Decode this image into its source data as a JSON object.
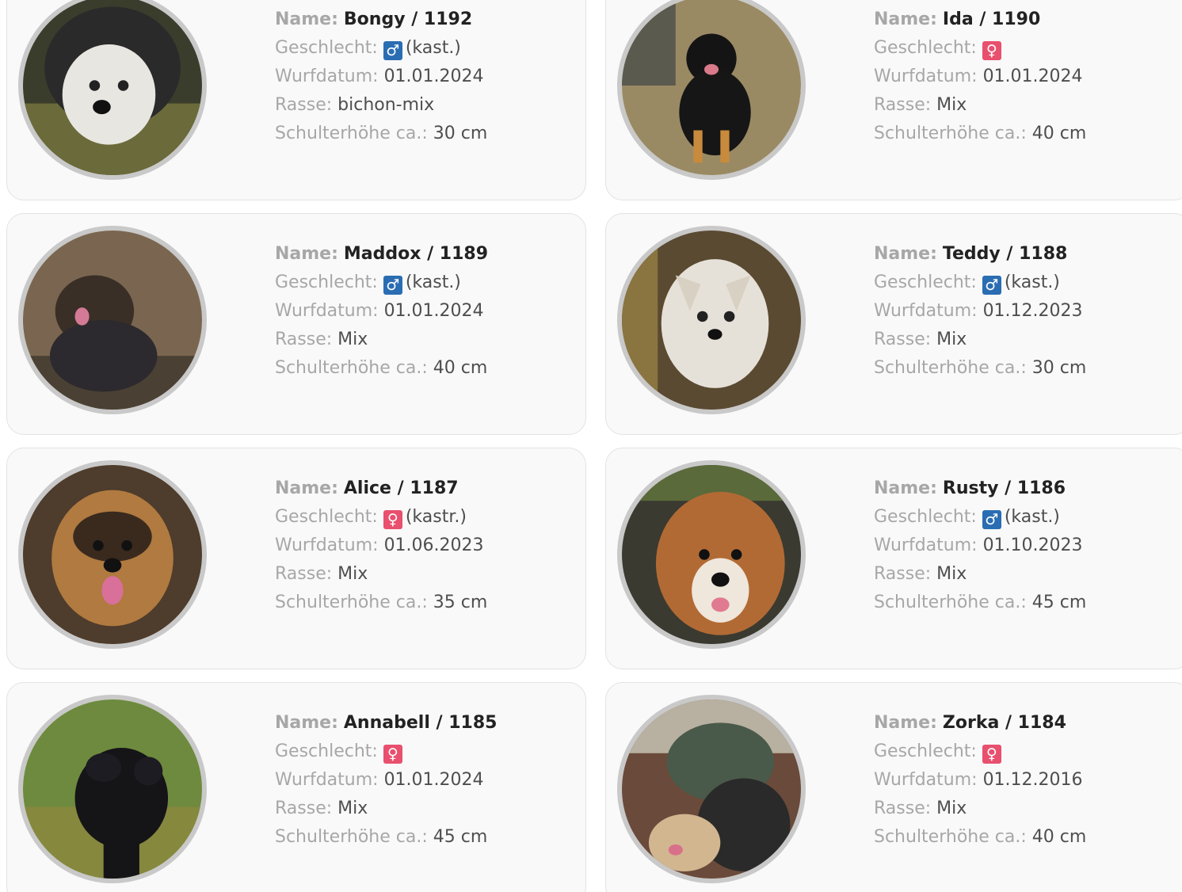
{
  "labels": {
    "name": "Name:",
    "sex": "Geschlecht:",
    "birth": "Wurfdatum:",
    "breed": "Rasse:",
    "height": "Schulterhöhe ca.:"
  },
  "dogs": [
    {
      "name": "Bongy / 1192",
      "sex_symbol": "♂",
      "sex": "male",
      "castration": "(kast.)",
      "birth": "01.01.2024",
      "breed": "bichon-mix",
      "height": "30 cm"
    },
    {
      "name": "Ida / 1190",
      "sex_symbol": "♀",
      "sex": "female",
      "castration": "",
      "birth": "01.01.2024",
      "breed": "Mix",
      "height": "40 cm"
    },
    {
      "name": "Maddox / 1189",
      "sex_symbol": "♂",
      "sex": "male",
      "castration": "(kast.)",
      "birth": "01.01.2024",
      "breed": "Mix",
      "height": "40 cm"
    },
    {
      "name": "Teddy / 1188",
      "sex_symbol": "♂",
      "sex": "male",
      "castration": "(kast.)",
      "birth": "01.12.2023",
      "breed": "Mix",
      "height": "30 cm"
    },
    {
      "name": "Alice / 1187",
      "sex_symbol": "♀",
      "sex": "female",
      "castration": "(kastr.)",
      "birth": "01.06.2023",
      "breed": "Mix",
      "height": "35 cm"
    },
    {
      "name": "Rusty / 1186",
      "sex_symbol": "♂",
      "sex": "male",
      "castration": "(kast.)",
      "birth": "01.10.2023",
      "breed": "Mix",
      "height": "45 cm"
    },
    {
      "name": "Annabell / 1185",
      "sex_symbol": "♀",
      "sex": "female",
      "castration": "",
      "birth": "01.01.2024",
      "breed": "Mix",
      "height": "45 cm"
    },
    {
      "name": "Zorka / 1184",
      "sex_symbol": "♀",
      "sex": "female",
      "castration": "",
      "birth": "01.12.2016",
      "breed": "Mix",
      "height": "40 cm"
    }
  ],
  "colors": {
    "male_badge": "#2a6db3",
    "female_badge": "#e8506e",
    "photo_ring": "#c9c9c9"
  }
}
